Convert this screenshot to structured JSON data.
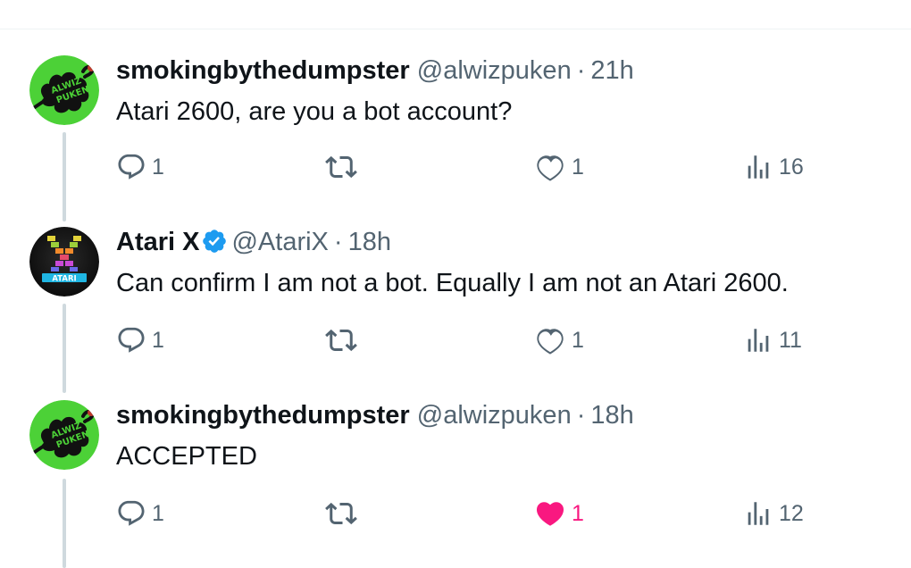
{
  "colors": {
    "text": "#0f1419",
    "muted": "#536471",
    "like_active": "#f91880",
    "verified": "#1d9bf0",
    "thread_line": "#cfd9de",
    "avatar_green": "#4cd137"
  },
  "tweets": [
    {
      "avatar_icon": "splat-logo-avatar",
      "name": "smokingbythedumpster",
      "handle": "@alwizpuken",
      "separator": "·",
      "time": "21h",
      "verified": false,
      "text": "Atari 2600, are you a bot account?",
      "replies": "1",
      "likes": "1",
      "views": "16",
      "liked": false
    },
    {
      "avatar_icon": "atari-x-avatar",
      "name": "Atari X",
      "handle": "@AtariX",
      "separator": "·",
      "time": "18h",
      "verified": true,
      "text": "Can confirm I am not a bot. Equally I am not an Atari 2600.",
      "replies": "1",
      "likes": "1",
      "views": "11",
      "liked": false
    },
    {
      "avatar_icon": "splat-logo-avatar",
      "name": "smokingbythedumpster",
      "handle": "@alwizpuken",
      "separator": "·",
      "time": "18h",
      "verified": false,
      "text": "ACCEPTED",
      "replies": "1",
      "likes": "1",
      "views": "12",
      "liked": true
    }
  ],
  "icons": {
    "reply": "reply-icon",
    "retweet": "retweet-icon",
    "like": "heart-icon",
    "views": "views-chart-icon",
    "verified": "verified-badge-icon"
  }
}
